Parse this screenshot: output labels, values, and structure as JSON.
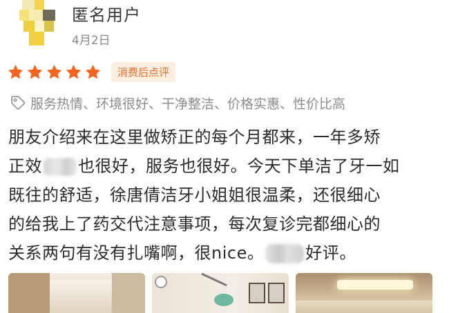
{
  "user": {
    "name": "匿名用户",
    "date": "4月2日"
  },
  "rating": {
    "stars": 5,
    "max_stars": 5,
    "star_color": "#f5651d",
    "badge": "消费后点评"
  },
  "tags": {
    "icon": "tag-icon",
    "text": "服务热情、环境很好、干净整洁、价格实惠、性价比高"
  },
  "review": {
    "line1": "朋友介绍来在这里做矫正的每个月都来，一年多矫",
    "line2_pre": "正效",
    "line2_post": "也很好，服务也很好。今天下单洁了牙一如",
    "line3": "既往的舒适，徐唐倩洁牙小姐姐很温柔，还很细心",
    "line4": "的给我上了药交代注意事项，每次复诊完都细心的",
    "line5_pre": "关系两句有没有扎嘴啊，很nice。",
    "line5_post": "好评。"
  },
  "photos": [
    {
      "subject": "clinic-hallway"
    },
    {
      "subject": "dental-chair-room"
    },
    {
      "subject": "clinic-lobby"
    }
  ]
}
